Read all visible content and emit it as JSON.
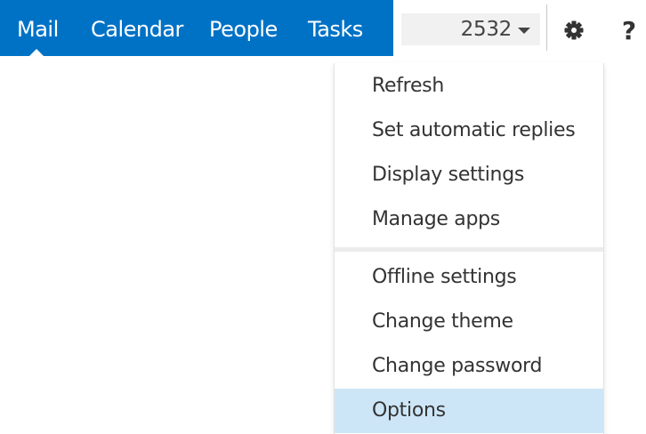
{
  "nav": {
    "items": [
      "Mail",
      "Calendar",
      "People",
      "Tasks"
    ],
    "active": "Mail",
    "bar_color": "#0072c6"
  },
  "header": {
    "user_label": "2532",
    "settings_icon": "gear-icon",
    "help_label": "?"
  },
  "menu": {
    "group1": [
      "Refresh",
      "Set automatic replies",
      "Display settings",
      "Manage apps"
    ],
    "group2": [
      "Offline settings",
      "Change theme",
      "Change password",
      "Options"
    ],
    "highlighted": "Options",
    "highlight_color": "#cde6f7"
  }
}
